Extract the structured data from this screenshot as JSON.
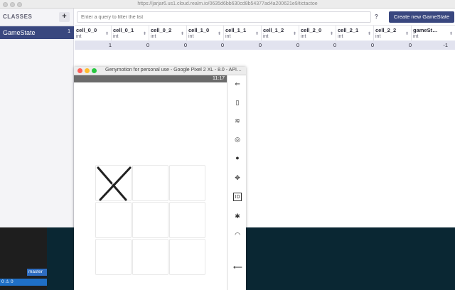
{
  "browser": {
    "url": "https://jarjar6.us1.cloud.realm.io/0635d6bb630cd8b54377ad4a200621e9/tictactoe"
  },
  "sidebar": {
    "title": "CLASSES",
    "add_label": "+",
    "items": [
      {
        "label": "GameState",
        "count": "1"
      }
    ]
  },
  "topbar": {
    "query_placeholder": "Enter a query to filter the list",
    "help_label": "?",
    "create_label": "Create new GameState"
  },
  "table": {
    "columns": [
      {
        "name": "cell_0_0",
        "type": "int"
      },
      {
        "name": "cell_0_1",
        "type": "int"
      },
      {
        "name": "cell_0_2",
        "type": "int"
      },
      {
        "name": "cell_1_0",
        "type": "int"
      },
      {
        "name": "cell_1_1",
        "type": "int"
      },
      {
        "name": "cell_1_2",
        "type": "int"
      },
      {
        "name": "cell_2_0",
        "type": "int"
      },
      {
        "name": "cell_2_1",
        "type": "int"
      },
      {
        "name": "cell_2_2",
        "type": "int"
      },
      {
        "name": "gameSt…",
        "type": "int"
      }
    ],
    "rows": [
      [
        "1",
        "0",
        "0",
        "0",
        "0",
        "0",
        "0",
        "0",
        "0",
        "-1"
      ]
    ]
  },
  "emulator": {
    "title": "Genymotion for personal use - Google Pixel 2 XL - 8.0 - API…",
    "status_time": "11:17",
    "board": {
      "cells": [
        "X",
        "",
        "",
        "",
        "",
        "",
        "",
        "",
        ""
      ]
    },
    "tool_icons": [
      "back-arrow-icon",
      "battery-icon",
      "wifi-icon",
      "camera-icon",
      "capture-icon",
      "move-icon",
      "id-icon",
      "settings-icon",
      "rss-icon",
      "nav-back-icon"
    ]
  },
  "ide": {
    "branch_label": "master",
    "status_label": "0 ⚠ 0"
  },
  "colors": {
    "accent": "#39477f",
    "row_highlight": "#e2e3ef",
    "desktop": "#0a2733"
  }
}
